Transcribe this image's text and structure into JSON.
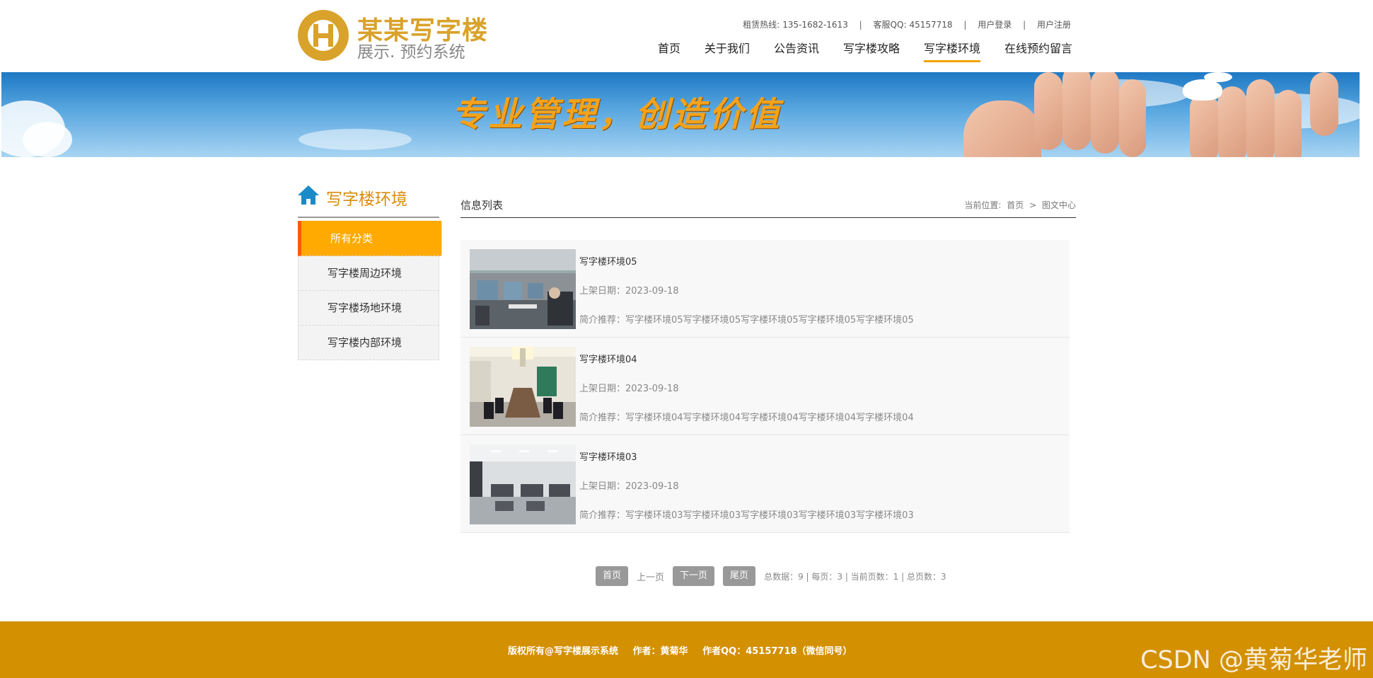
{
  "header": {
    "logo_title": "某某写字楼",
    "logo_subtitle": "展示. 预约系统",
    "hotline_label": "租赁热线:",
    "hotline": "135-1682-1613",
    "qq_label": "客服QQ:",
    "qq": "45157718",
    "login": "用户登录",
    "register": "用户注册",
    "nav": [
      {
        "label": "首页"
      },
      {
        "label": "关于我们"
      },
      {
        "label": "公告资讯"
      },
      {
        "label": "写字楼攻略"
      },
      {
        "label": "写字楼环境"
      },
      {
        "label": "在线预约留言"
      }
    ],
    "active_nav": "写字楼环境"
  },
  "banner": {
    "slogan": "专业管理，创造价值"
  },
  "sidebar": {
    "title": "写字楼环境",
    "items": [
      {
        "label": "所有分类"
      },
      {
        "label": "写字楼周边环境"
      },
      {
        "label": "写字楼场地环境"
      },
      {
        "label": "写字楼内部环境"
      }
    ],
    "active": "所有分类"
  },
  "content": {
    "heading": "信息列表",
    "breadcrumb_label": "当前位置:",
    "breadcrumb_home": "首页",
    "breadcrumb_sep": ">",
    "breadcrumb_current": "图文中心",
    "items": [
      {
        "title": "写字楼环境05",
        "date": "上架日期：2023-09-18",
        "desc": "简介推荐：写字楼环境05写字楼环境05写字楼环境05写字楼环境05写字楼环境05"
      },
      {
        "title": "写字楼环境04",
        "date": "上架日期：2023-09-18",
        "desc": "简介推荐：写字楼环境04写字楼环境04写字楼环境04写字楼环境04写字楼环境04"
      },
      {
        "title": "写字楼环境03",
        "date": "上架日期：2023-09-18",
        "desc": "简介推荐：写字楼环境03写字楼环境03写字楼环境03写字楼环境03写字楼环境03"
      }
    ]
  },
  "pagination": {
    "first": "首页",
    "prev": "上一页",
    "next": "下一页",
    "last": "尾页",
    "stats": "总数据：9 | 每页：3 | 当前页数：1 | 总页数：3"
  },
  "footer": {
    "copyright": "版权所有@写字楼展示系统",
    "author": "作者：黄菊华",
    "author_qq": "作者QQ：45157718（微信同号）",
    "watermark": "CSDN @黄菊华老师"
  },
  "colors": {
    "accent": "#ffaa00",
    "footer": "#d39000",
    "logo": "#d9a22b",
    "icon": "#1a8ac8"
  }
}
